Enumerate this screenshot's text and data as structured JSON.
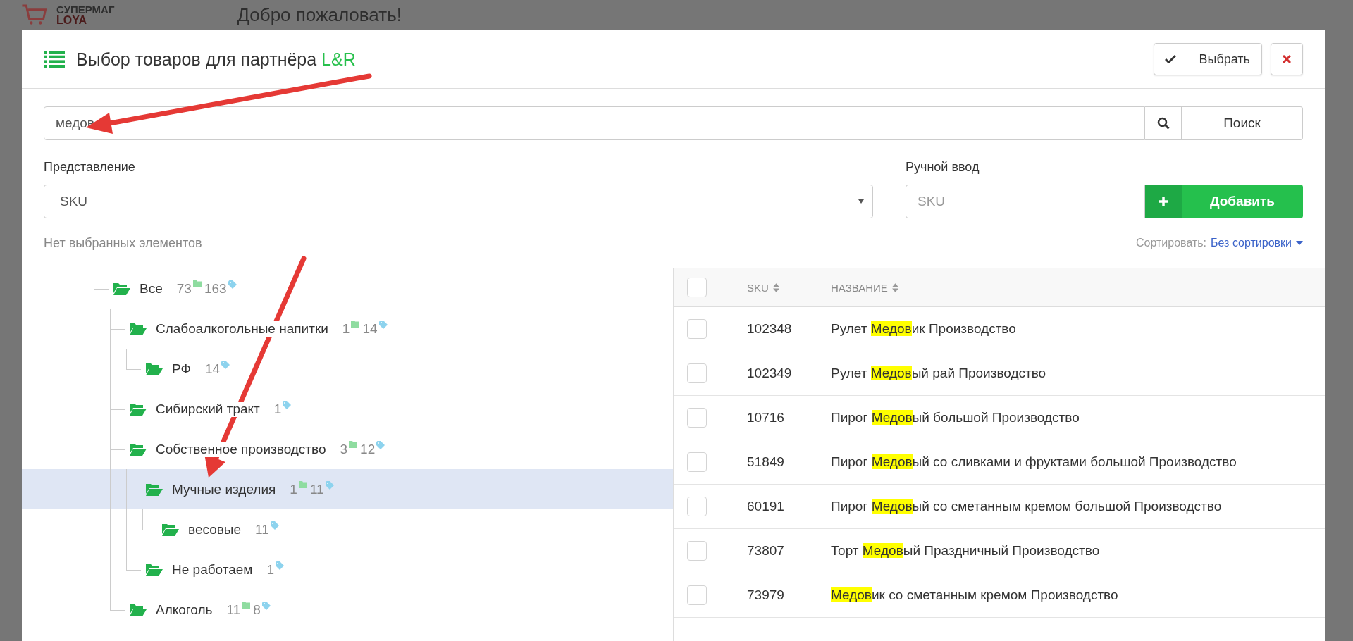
{
  "background": {
    "logo_top": "СУПЕРМАГ",
    "logo_bottom": "LOYA",
    "welcome": "Добро пожаловать!"
  },
  "dialog": {
    "title": "Выбор товаров для партнёра",
    "partner": "L&R",
    "select_button": "Выбрать"
  },
  "search": {
    "value": "медов",
    "button": "Поиск"
  },
  "view": {
    "label": "Представление",
    "value": "SKU"
  },
  "manual": {
    "label": "Ручной ввод",
    "placeholder": "SKU",
    "button": "Добавить"
  },
  "selection_note": "Нет выбранных элементов",
  "sort": {
    "label": "Сортировать:",
    "value": "Без сортировки"
  },
  "tree": [
    {
      "label": "Все",
      "folders": "73",
      "products": "163",
      "selected": false,
      "children": [
        {
          "label": "Слабоалкогольные напитки",
          "folders": "1",
          "products": "14",
          "selected": false,
          "children": [
            {
              "label": "РФ",
              "products": "14",
              "selected": false
            }
          ]
        },
        {
          "label": "Сибирский тракт",
          "products": "1",
          "selected": false
        },
        {
          "label": "Собственное производство",
          "folders": "3",
          "products": "12",
          "selected": false,
          "children": [
            {
              "label": "Мучные изделия",
              "folders": "1",
              "products": "11",
              "selected": true,
              "children": [
                {
                  "label": "весовые",
                  "products": "11",
                  "selected": false
                }
              ]
            },
            {
              "label": "Не работаем",
              "products": "1",
              "selected": false
            }
          ]
        },
        {
          "label": "Алкоголь",
          "folders": "11",
          "products": "8",
          "selected": false
        }
      ]
    }
  ],
  "table": {
    "all_checked": false,
    "columns": [
      "SKU",
      "НАЗВАНИЕ"
    ],
    "rows": [
      {
        "checked": false,
        "sku": "102348",
        "name_before": "Рулет ",
        "match": "Медов",
        "name_after": "ик Производство"
      },
      {
        "checked": false,
        "sku": "102349",
        "name_before": "Рулет ",
        "match": "Медов",
        "name_after": "ый рай Производство"
      },
      {
        "checked": false,
        "sku": "10716",
        "name_before": "Пирог ",
        "match": "Медов",
        "name_after": "ый большой Производство"
      },
      {
        "checked": false,
        "sku": "51849",
        "name_before": "Пирог ",
        "match": "Медов",
        "name_after": "ый со сливками и фруктами большой Производство"
      },
      {
        "checked": false,
        "sku": "60191",
        "name_before": "Пирог ",
        "match": "Медов",
        "name_after": "ый со сметанным кремом большой Производство"
      },
      {
        "checked": false,
        "sku": "73807",
        "name_before": "Торт ",
        "match": "Медов",
        "name_after": "ый Праздничный Производство"
      },
      {
        "checked": false,
        "sku": "73979",
        "name_before": "",
        "match": "Медов",
        "name_after": "ик со сметанным кремом Производство"
      }
    ]
  }
}
